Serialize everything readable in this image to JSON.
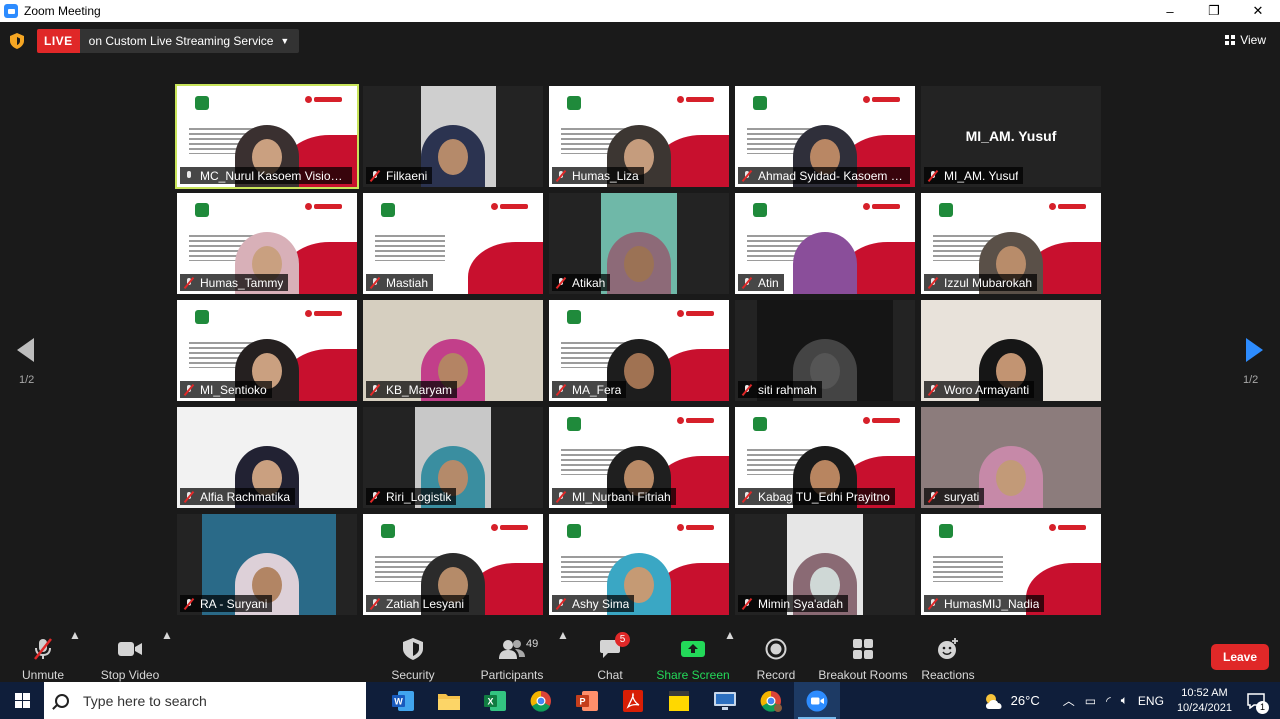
{
  "window": {
    "title": "Zoom Meeting",
    "min_label": "–",
    "max_label": "❐",
    "close_label": "✕"
  },
  "live": {
    "badge": "LIVE",
    "service": "on Custom Live Streaming Service"
  },
  "view": {
    "label": "View"
  },
  "pagination": {
    "left": "1/2",
    "right": "1/2"
  },
  "tiles": [
    {
      "name": "MC_Nurul Kasoem Vision ...",
      "kind": "slide",
      "active": true,
      "mic": "open",
      "person": "#3a3030",
      "skin": "#caa080"
    },
    {
      "name": "Filkaeni",
      "kind": "cam",
      "cam": "#cfcfcf",
      "frame": [
        58,
        75
      ],
      "person": "#2b3350",
      "skin": "#b58a6a"
    },
    {
      "name": "Humas_Liza",
      "kind": "slide",
      "person": "#3c3632",
      "skin": "#c59c7d"
    },
    {
      "name": "Ahmad Syidad- Kasoem Vi...",
      "kind": "slide",
      "person": "#2f2f3a",
      "skin": "#b98764"
    },
    {
      "name": "MI_AM. Yusuf",
      "kind": "name",
      "center": "MI_AM. Yusuf"
    },
    {
      "name": "Humas_Tammy",
      "kind": "slide",
      "person": "#d8b0b8",
      "skin": "#c9a080"
    },
    {
      "name": "Mastiah",
      "kind": "slide"
    },
    {
      "name": "Atikah",
      "kind": "cam",
      "cam": "#6fb8a8",
      "frame": [
        52,
        76
      ],
      "person": "#8d6a78",
      "skin": "#9b7255"
    },
    {
      "name": "Atin",
      "kind": "slide",
      "person": "#8a4e9a",
      "skin": "#8a4e9a"
    },
    {
      "name": "Izzul Mubarokah",
      "kind": "slide",
      "person": "#5a5048",
      "skin": "#b88c6a"
    },
    {
      "name": "MI_Sentioko",
      "kind": "slide",
      "person": "#252020",
      "skin": "#caa080"
    },
    {
      "name": "KB_Maryam",
      "kind": "cam",
      "cam": "#d6cfc0",
      "frame": [
        0,
        180
      ],
      "person": "#c23f8a",
      "skin": "#b48464"
    },
    {
      "name": "MA_Fera",
      "kind": "slide",
      "person": "#1d1d1d",
      "skin": "#a07252"
    },
    {
      "name": "siti rahmah",
      "kind": "cam",
      "cam": "#151515",
      "frame": [
        22,
        136
      ],
      "person": "#444444",
      "skin": "#555555"
    },
    {
      "name": "Woro Armayanti",
      "kind": "cam",
      "cam": "#e8e2da",
      "frame": [
        0,
        180
      ],
      "person": "#161616",
      "skin": "#c29472"
    },
    {
      "name": "Alfia Rachmatika",
      "kind": "cam",
      "cam": "#f2f2f2",
      "frame": [
        0,
        180
      ],
      "person": "#222233",
      "skin": "#caa080"
    },
    {
      "name": "Riri_Logistik",
      "kind": "cam",
      "cam": "#c8c8c8",
      "frame": [
        52,
        76
      ],
      "person": "#3a8ea0",
      "skin": "#b48a6a"
    },
    {
      "name": "MI_Nurbani Fitriah",
      "kind": "slide",
      "person": "#1f1f1f",
      "skin": "#b98a66"
    },
    {
      "name": "Kabag TU_Edhi Prayitno",
      "kind": "slide",
      "person": "#1b1b1b",
      "skin": "#b88560"
    },
    {
      "name": "suryati",
      "kind": "cam",
      "cam": "#8c7c7c",
      "frame": [
        0,
        180
      ],
      "person": "#c689a8",
      "skin": "#c29a78"
    },
    {
      "name": "RA - Suryani",
      "kind": "cam",
      "cam": "#2a6a88",
      "frame": [
        25,
        134
      ],
      "person": "#ddd0d8",
      "skin": "#b28564"
    },
    {
      "name": "Zatiah Lesyani",
      "kind": "slide",
      "person": "#2b2b2b",
      "skin": "#b58b69"
    },
    {
      "name": "Ashy Sima",
      "kind": "slide",
      "person": "#3aa7c4",
      "skin": "#c59a74"
    },
    {
      "name": "Mimin Sya'adah",
      "kind": "cam",
      "cam": "#e6e6e6",
      "frame": [
        52,
        76
      ],
      "person": "#8a6a74",
      "skin": "#cfd8d6"
    },
    {
      "name": "HumasMIJ_Nadia",
      "kind": "slide"
    }
  ],
  "toolbar": {
    "unmute": "Unmute",
    "stop_video": "Stop Video",
    "security": "Security",
    "participants": "Participants",
    "participants_count": "49",
    "chat": "Chat",
    "chat_badge": "5",
    "share_screen": "Share Screen",
    "record": "Record",
    "breakout_rooms": "Breakout Rooms",
    "reactions": "Reactions",
    "leave": "Leave"
  },
  "taskbar": {
    "search_placeholder": "Type here to search",
    "weather": "26°C",
    "language": "ENG",
    "time": "10:52 AM",
    "date": "10/24/2021",
    "notification_count": "1"
  },
  "colors": {
    "live_red": "#e02828",
    "active_speaker": "#c8e45a",
    "share_green": "#23d959",
    "nav_blue": "#2d8cff"
  }
}
